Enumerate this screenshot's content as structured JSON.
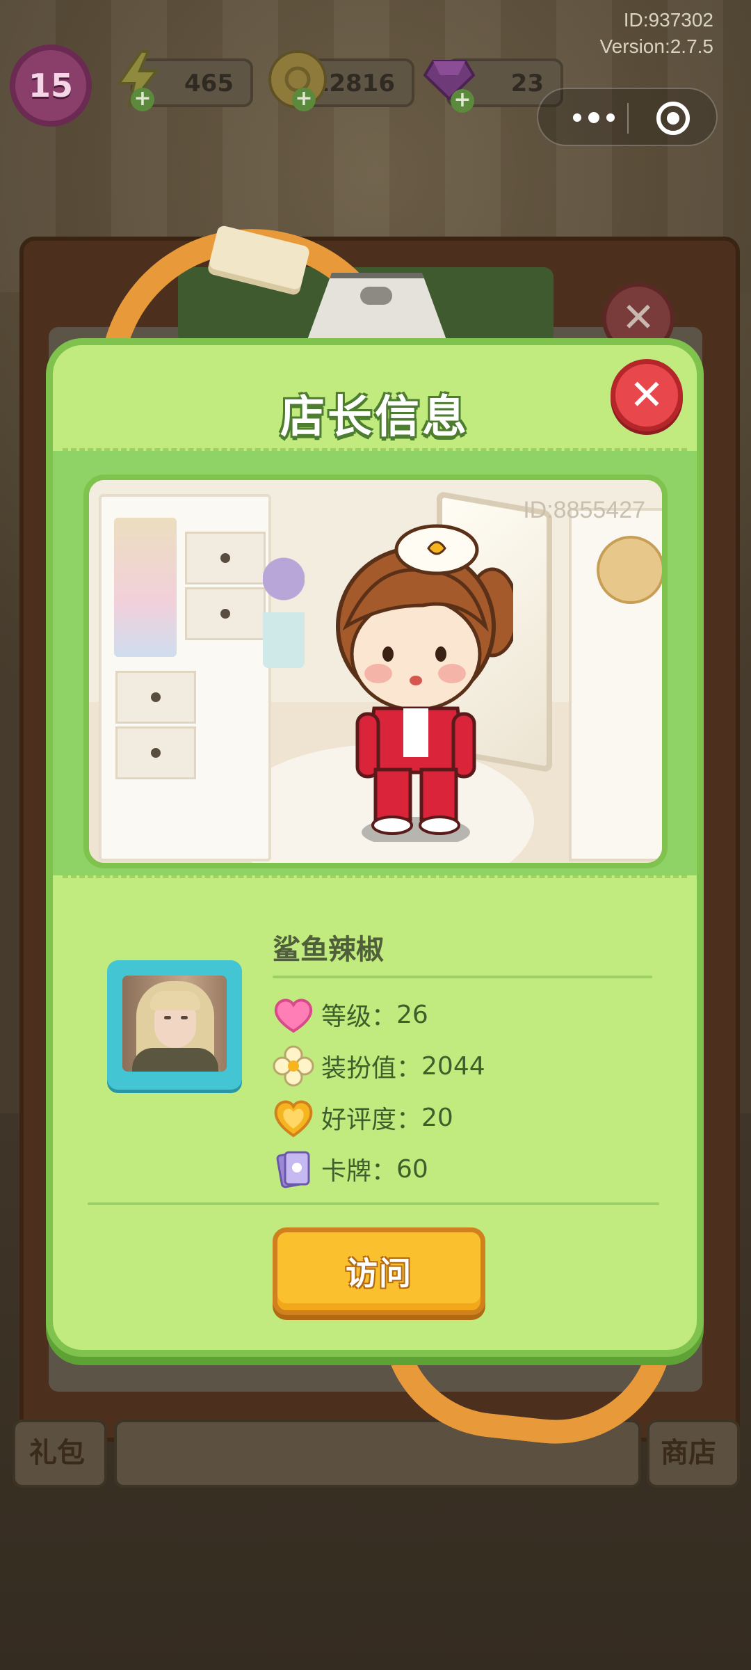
{
  "hud": {
    "player_id": "ID:937302",
    "version": "Version:2.7.5",
    "level": "15",
    "energy": "465",
    "coins": "12816",
    "gems": "23"
  },
  "dialog": {
    "title": "店长信息",
    "close_icon": "close-icon",
    "showcase_id": "ID:8855427",
    "owner_name": "鲨鱼辣椒",
    "stats": [
      {
        "label": "等级：",
        "value": "26",
        "icon": "heart-icon",
        "color": "#ff7eb6"
      },
      {
        "label": "装扮值：",
        "value": "2044",
        "icon": "flower-icon",
        "color": "#fff3c8"
      },
      {
        "label": "好评度：",
        "value": "20",
        "icon": "golden-heart-icon",
        "color": "#f6b51e"
      },
      {
        "label": "卡牌：",
        "value": "60",
        "icon": "card-icon",
        "color": "#b8a6e6"
      }
    ],
    "visit_button": "访问"
  },
  "background": {
    "tab_left": "礼包",
    "tab_right": "商店"
  },
  "colors": {
    "dialog_green": "#c2eb7f",
    "dialog_border": "#7fc24d",
    "close_red": "#e8474c",
    "visit_yellow": "#fbc02d",
    "avatar_frame": "#43c5d3"
  }
}
